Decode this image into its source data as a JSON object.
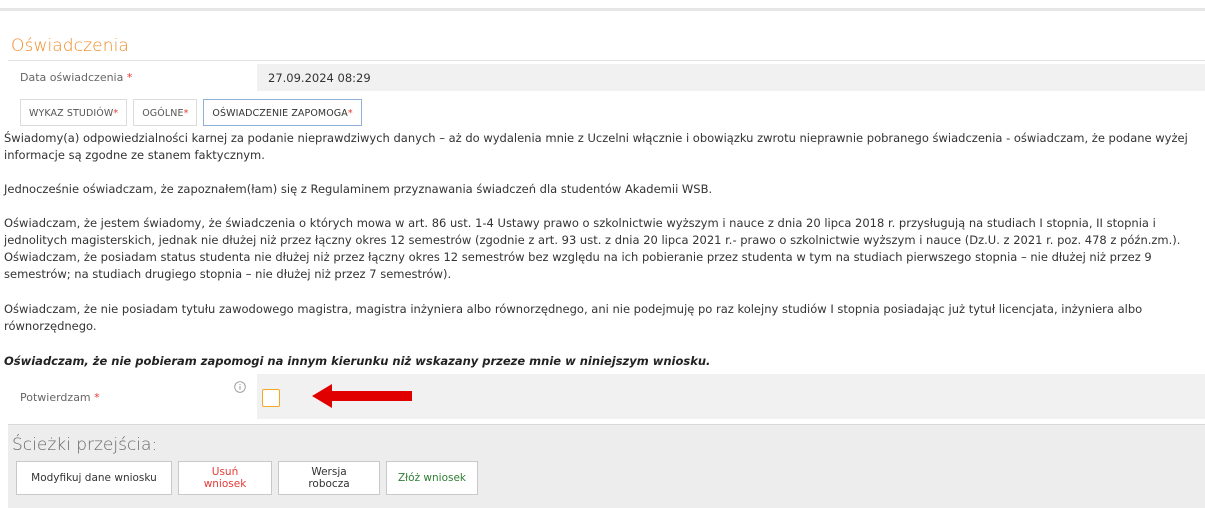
{
  "section": {
    "title": "Oświadczenia"
  },
  "date_field": {
    "label": "Data oświadczenia",
    "required_mark": "*",
    "value": "27.09.2024 08:29"
  },
  "tabs": [
    {
      "label": "WYKAZ STUDIÓW",
      "required_mark": "*",
      "active": false
    },
    {
      "label": "OGÓLNE",
      "required_mark": "*",
      "active": false
    },
    {
      "label": "OŚWIADCZENIE ZAPOMOGA",
      "required_mark": "*",
      "active": true
    }
  ],
  "declarations": {
    "p1": "Świadomy(a) odpowiedzialności karnej za podanie nieprawdziwych danych – aż do wydalenia mnie z Uczelni włącznie i obowiązku zwrotu nieprawnie pobranego świadczenia - oświadczam, że podane wyżej informacje są zgodne ze stanem faktycznym.",
    "p2": "Jednocześnie oświadczam, że zapoznałem(łam) się z Regulaminem przyznawania świadczeń dla studentów Akademii WSB.",
    "p3": "Oświadczam, że jestem świadomy, że świadczenia o których mowa w art. 86 ust. 1-4 Ustawy prawo o szkolnictwie wyższym i nauce z dnia 20 lipca 2018 r. przysługują na studiach I stopnia, II stopnia i jednolitych magisterskich, jednak nie dłużej niż przez łączny okres 12 semestrów (zgodnie z art. 93 ust. z dnia 20 lipca 2021 r.- prawo o szkolnictwie wyższym i nauce (Dz.U. z 2021 r. poz. 478 z późn.zm.). Oświadczam, że posiadam status studenta nie dłużej niż przez łączny okres 12 semestrów bez względu na ich pobieranie przez studenta w tym na studiach pierwszego stopnia – nie dłużej niż przez 9 semestrów; na studiach drugiego stopnia – nie dłużej niż przez 7 semestrów).",
    "p4": "Oświadczam, że nie posiadam tytułu zawodowego magistra, magistra inżyniera albo równorzędnego, ani nie podejmuję po raz kolejny studiów I stopnia posiadając już tytuł licencjata, inżyniera albo równorzędnego.",
    "p5": "Oświadczam, że nie pobieram zapomogi na innym kierunku niż wskazany przeze mnie w niniejszym wniosku."
  },
  "confirm": {
    "label": "Potwierdzam",
    "required_mark": "*",
    "info_icon": "info-circle-icon",
    "checked": false,
    "annotation_icon": "red-arrow-left-icon",
    "annotation_color": "#e00000"
  },
  "paths": {
    "title": "Ścieżki przejścia:",
    "buttons": {
      "modify": "Modyfikuj dane wniosku",
      "delete": "Usuń wniosek",
      "draft": "Wersja robocza",
      "submit": "Złóż wniosek"
    }
  },
  "colors": {
    "accent": "#f08a24",
    "required": "#e53935",
    "delete": "#e53935",
    "submit": "#2e7d32",
    "checkbox_border": "#f5a623"
  }
}
